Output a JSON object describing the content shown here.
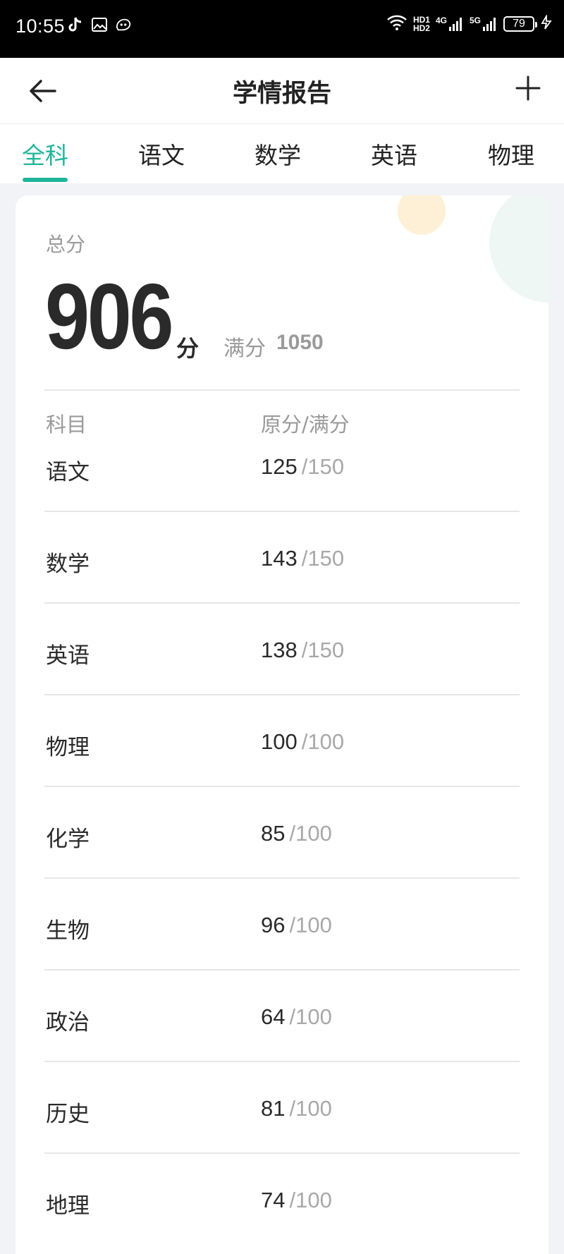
{
  "status_bar": {
    "time": "10:55",
    "hd1": "HD1",
    "hd2": "HD2",
    "net1": "4G",
    "net2": "5G",
    "battery": "79"
  },
  "navbar": {
    "title": "学情报告"
  },
  "tabs": [
    {
      "label": "全科",
      "active": true
    },
    {
      "label": "语文",
      "active": false
    },
    {
      "label": "数学",
      "active": false
    },
    {
      "label": "英语",
      "active": false
    },
    {
      "label": "物理",
      "active": false
    }
  ],
  "summary": {
    "total_label": "总分",
    "total_score": "906",
    "total_unit": "分",
    "full_label": "满分",
    "full_value": "1050"
  },
  "table": {
    "headers": {
      "subject": "科目",
      "score": "原分/满分"
    },
    "rows": [
      {
        "subject": "语文",
        "raw": "125",
        "full": "/150"
      },
      {
        "subject": "数学",
        "raw": "143",
        "full": "/150"
      },
      {
        "subject": "英语",
        "raw": "138",
        "full": "/150"
      },
      {
        "subject": "物理",
        "raw": "100",
        "full": "/100"
      },
      {
        "subject": "化学",
        "raw": "85",
        "full": "/100"
      },
      {
        "subject": "生物",
        "raw": "96",
        "full": "/100"
      },
      {
        "subject": "政治",
        "raw": "64",
        "full": "/100"
      },
      {
        "subject": "历史",
        "raw": "81",
        "full": "/100"
      },
      {
        "subject": "地理",
        "raw": "74",
        "full": "/100"
      }
    ]
  },
  "colors": {
    "accent": "#20b59a",
    "text": "#2a2a2a",
    "muted": "#9a9a9a"
  }
}
